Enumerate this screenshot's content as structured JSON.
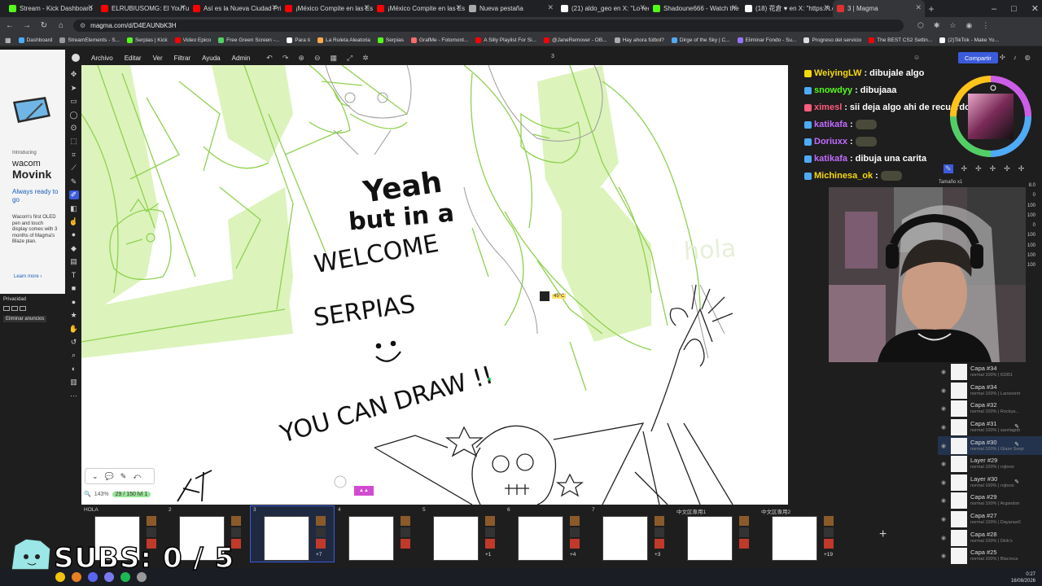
{
  "browser": {
    "tabs": [
      {
        "title": "Stream - Kick Dashboard",
        "color": "#53fc18"
      },
      {
        "title": "ELRUBIUSOMG: El YouTuber C",
        "color": "#ff0000"
      },
      {
        "title": "Así es la Nueva Ciudad Privad",
        "color": "#ff0000"
      },
      {
        "title": "¡México Compite en las Escon",
        "color": "#ff0000"
      },
      {
        "title": "¡México Compite en las Escon",
        "color": "#ff0000"
      },
      {
        "title": "Nueva pestaña",
        "color": "#aaaaaa"
      },
      {
        "title": "(21) aldo_geo en X: \"Lo recon",
        "color": "#ffffff"
      },
      {
        "title": "Shadoune666 - Watch the VO",
        "color": "#53fc18"
      },
      {
        "title": "(18) 花倉 ♥ en X: \"https://t.co",
        "color": "#ffffff"
      },
      {
        "title": "3 | Magma",
        "color": "#e03131"
      }
    ],
    "url": "magma.com/d/D4EAUNbK3H",
    "bookmarks": [
      "Dashboard",
      "StreamElements - S...",
      "Serpias | Kick",
      "Video Epico",
      "Free Green Screen -...",
      "Para ti",
      "La Ruleta Aleatoria",
      "Serpias",
      "GrafMe - Fotomont...",
      "A Silly Playlist For Si...",
      "@JaneRemover - OB...",
      "Hay ahora fútbol?",
      "Dirge of the Sky | C...",
      "Eliminar Fondo - Su...",
      "Progreso del servicio",
      "The BEST CS2 Settin...",
      "(2)TikTok - Make Yo..."
    ]
  },
  "ad": {
    "intro": "Introducing",
    "brand": "wacom",
    "product": "Movink",
    "tagline": "Always ready to go",
    "body": "Wacom's first OLED pen and touch display comes with 3 months of Magma's Blaze plan.",
    "learn_more": "Learn more ›",
    "privacy": "Privacidad",
    "remove": "Eliminar anuncios"
  },
  "menu": {
    "items": [
      "Archivo",
      "Editar",
      "Ver",
      "Filtrar",
      "Ayuda",
      "Admin"
    ],
    "page_num": "3",
    "share": "Compartir"
  },
  "canvas": {
    "text_lines": [
      "Yeah",
      "but in a",
      "WELCOME",
      "SERPIAS",
      "YOU CAN DRAW !!",
      "hola"
    ],
    "temp": "45°C",
    "zoom": "143%",
    "counter": "29 / 150 lvl 1"
  },
  "chat": [
    {
      "user": "WeiyingLW",
      "color": "#f5d90a",
      "message": "dibujale algo"
    },
    {
      "user": "snowdyy",
      "color": "#53fc18",
      "message": "dibujaaa"
    },
    {
      "user": "ximesl",
      "color": "#ff5b7d",
      "message": "sii deja algo ahi de recuerdo"
    },
    {
      "user": "katikafa",
      "color": "#c16bff",
      "message": ""
    },
    {
      "user": "Doriuxx",
      "color": "#c16bff",
      "message": ""
    },
    {
      "user": "katikafa",
      "color": "#c16bff",
      "message": "dibuja una carita"
    },
    {
      "user": "Michinesa_ok",
      "color": "#f5d90a",
      "message": ""
    }
  ],
  "brush": {
    "size_label": "Tamaño x1",
    "values": [
      "8.0",
      "0",
      "100",
      "100",
      "0",
      "100",
      "100",
      "100",
      "100"
    ]
  },
  "layers": [
    {
      "name": "Capa #34",
      "sub": "normal 100% | 63351"
    },
    {
      "name": "Capa #34",
      "sub": "normal 100% | Lansoorm"
    },
    {
      "name": "Capa #32",
      "sub": "normal 100% | Rockya..."
    },
    {
      "name": "Capa #31",
      "sub": "normal 100% | sanrlagob"
    },
    {
      "name": "Capa #30",
      "sub": "normal 100% | Glaze Serpi"
    },
    {
      "name": "Layer #29",
      "sub": "normal 100% | rojtooo"
    },
    {
      "name": "Layer #30",
      "sub": "normal 100% | rojtooo"
    },
    {
      "name": "Capa #29",
      "sub": "normal 100% | Argandon"
    },
    {
      "name": "Capa #27",
      "sub": "normal 100% | Dayanax0"
    },
    {
      "name": "Capa #28",
      "sub": "normal 100% | Dink's"
    },
    {
      "name": "Capa #25",
      "sub": "normal 100% | Blacroca"
    },
    {
      "name": "Capa #23",
      "sub": "normal 100% | ..."
    }
  ],
  "drawings": [
    {
      "num": "HOLA",
      "more": ""
    },
    {
      "num": "2",
      "more": ""
    },
    {
      "num": "3",
      "more": "+7"
    },
    {
      "num": "4",
      "more": ""
    },
    {
      "num": "5",
      "more": "+1"
    },
    {
      "num": "6",
      "more": "+4"
    },
    {
      "num": "7",
      "more": "+3"
    },
    {
      "num": "中文区専用1",
      "more": ""
    },
    {
      "num": "中文区専用2",
      "more": "+19"
    }
  ],
  "overlay": {
    "subs": "SUBS: 0 / 5"
  },
  "clock": {
    "time": "0:27",
    "date": "16/08/2026"
  }
}
